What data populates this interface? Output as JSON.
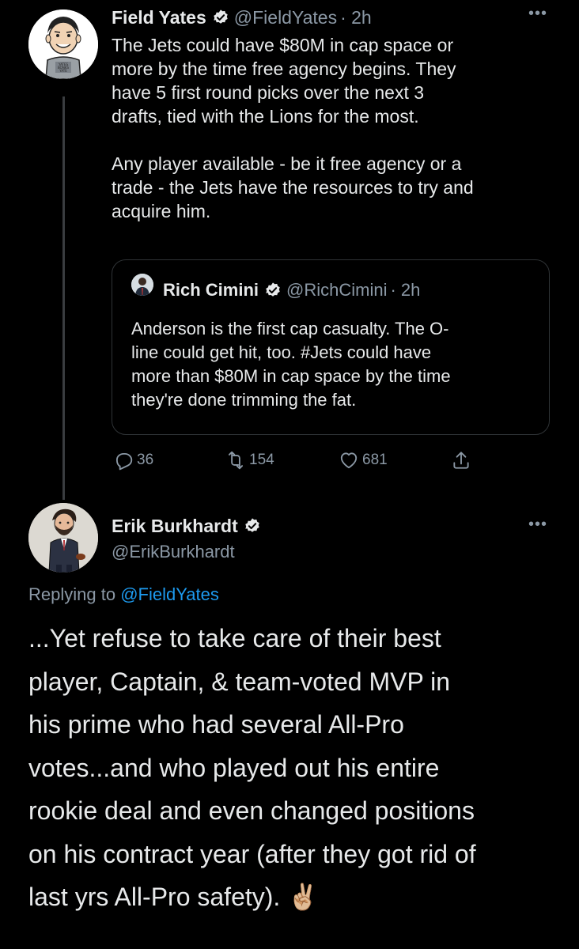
{
  "parent_tweet": {
    "display_name": "Field Yates",
    "handle": "@FieldYates",
    "time": "· 2h",
    "more_label": "•••",
    "text": "The Jets could have $80M in cap space or\nmore by the time free agency begins. They\nhave 5 first round picks over the next 3\ndrafts, tied with the Lions for the most.\n\nAny player available - be it free agency or a\ntrade - the Jets have the resources to try and\nacquire him.",
    "avatar_shirt_text": "YATESO BONKS YATE"
  },
  "quoted_tweet": {
    "display_name": "Rich Cimini",
    "handle": "@RichCimini",
    "time": "· 2h",
    "text": "Anderson is the first cap casualty. The O-\nline could get hit, too. #Jets could have\nmore than $80M in cap space by the time\nthey're done trimming the fat."
  },
  "actions": {
    "reply_count": "36",
    "retweet_count": "154",
    "like_count": "681"
  },
  "reply_tweet": {
    "display_name": "Erik Burkhardt",
    "handle": "@ErikBurkhardt",
    "more_label": "•••",
    "replying_prefix": "Replying to ",
    "replying_to": "@FieldYates",
    "text": "...Yet refuse to take care of their best\nplayer, Captain, & team-voted MVP in\nhis prime who had several All-Pro\nvotes...and who played out his entire\nrookie deal and even changed positions\non his contract year (after they got rid of\nlast yrs All-Pro safety). ✌🏼"
  },
  "icons": {
    "verified": "verified-badge-icon",
    "reply": "reply-icon",
    "retweet": "retweet-icon",
    "like": "heart-icon",
    "share": "share-icon"
  },
  "colors": {
    "background": "#000000",
    "text_primary": "#e7e9ea",
    "text_secondary": "#8b98a5",
    "accent": "#1d9bf0",
    "border": "#2f3336"
  }
}
